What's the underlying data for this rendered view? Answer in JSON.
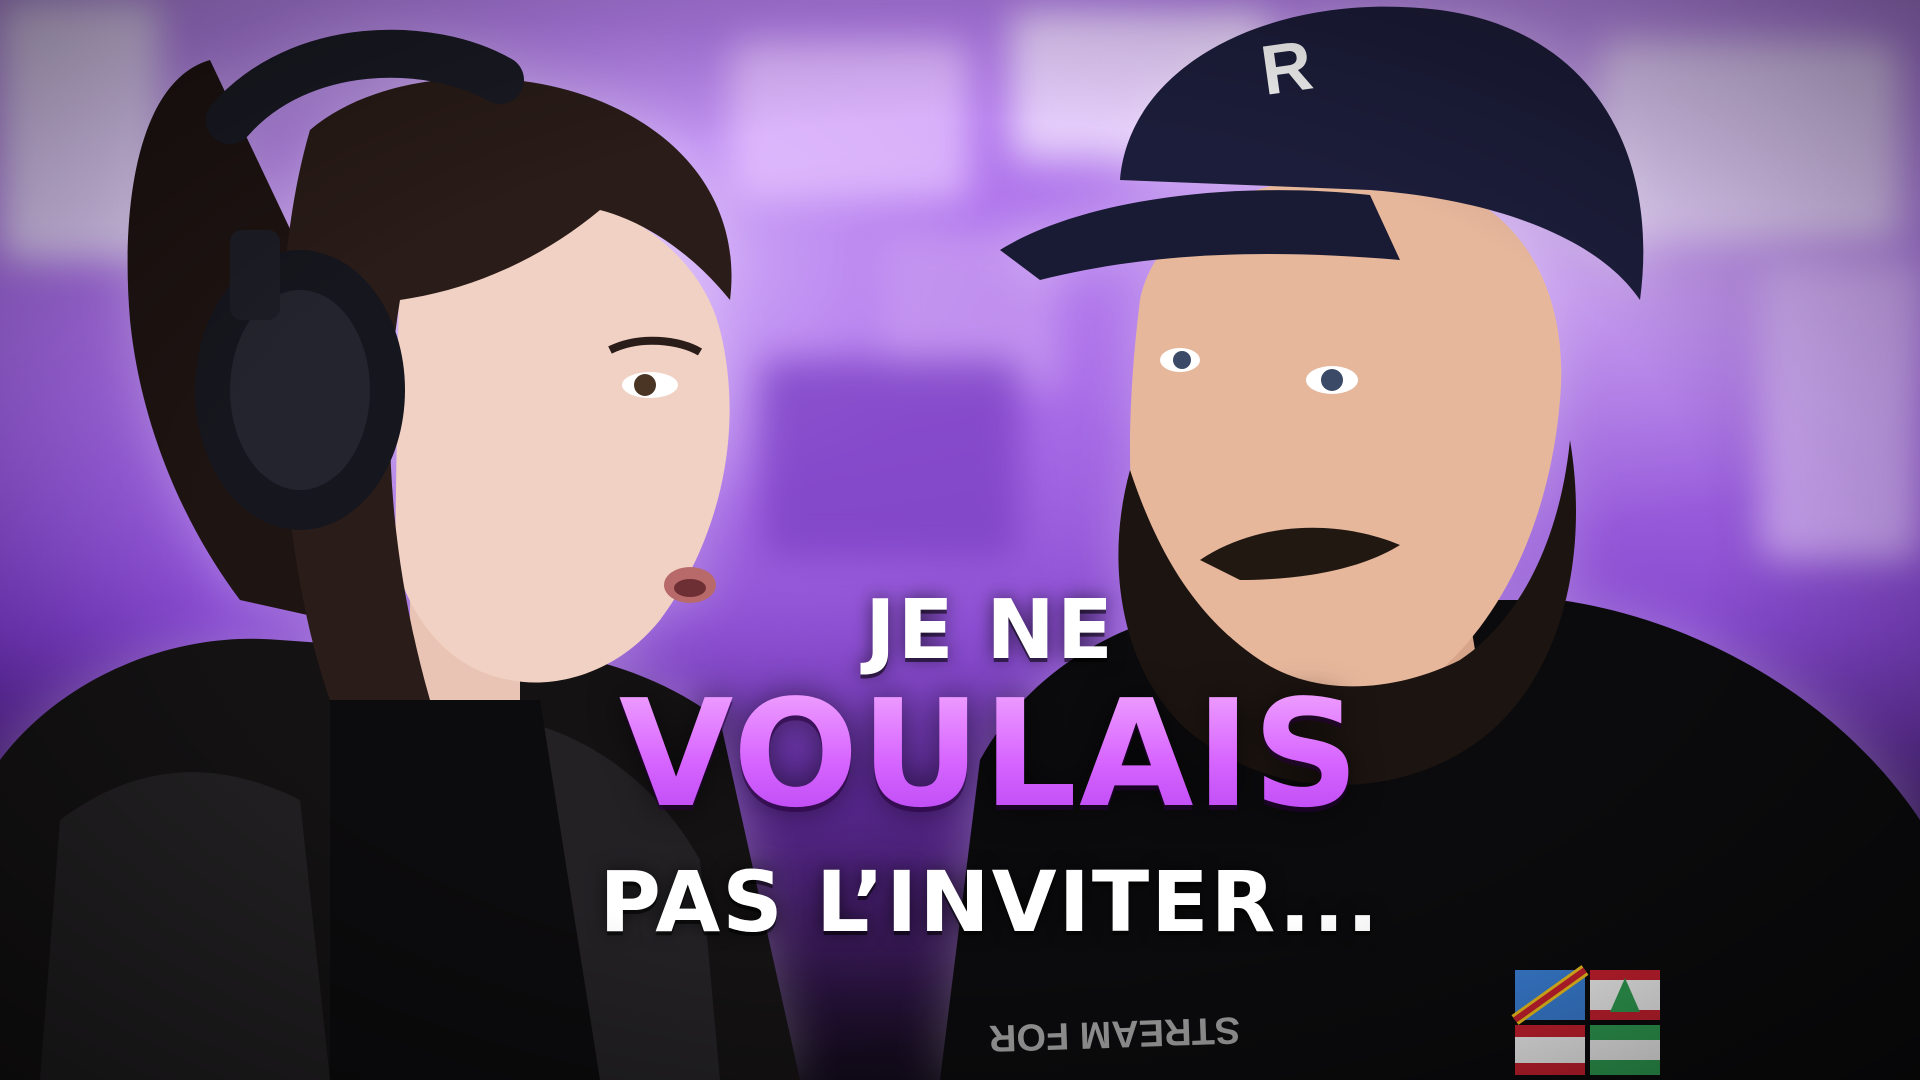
{
  "thumbnail": {
    "headline": {
      "line1": "JE NE",
      "line2": "VOULAIS",
      "line3": "PAS L’INVITER..."
    },
    "shirt_print": "STREAM FOR",
    "colors": {
      "accent_purple": "#d765ff",
      "headline_white": "#ffffff",
      "background_violet": "#9a62e0"
    }
  }
}
